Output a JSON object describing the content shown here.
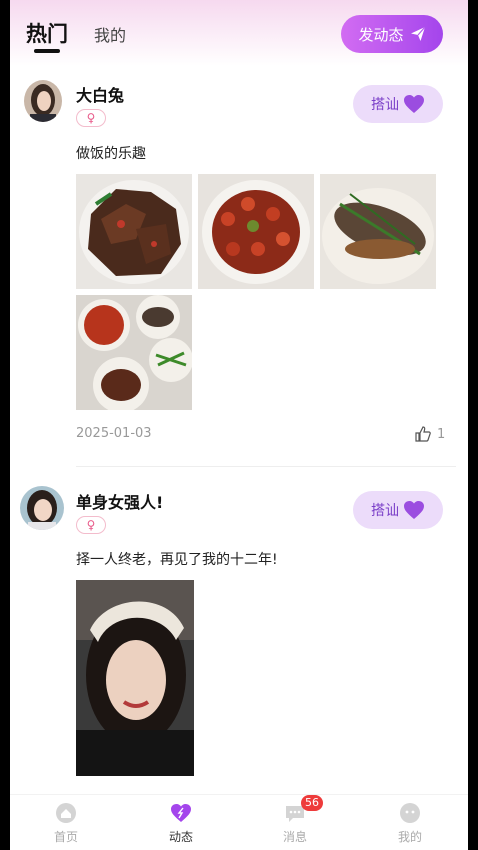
{
  "header": {
    "tab_hot": "热门",
    "tab_mine": "我的",
    "post_button": "发动态"
  },
  "posts": [
    {
      "username": "大白兔",
      "gender_symbol": "♀",
      "greet_label": "搭讪",
      "text": "做饭的乐趣",
      "date": "2025-01-03",
      "likes": "1"
    },
    {
      "username": "单身女强人!",
      "gender_symbol": "♀",
      "greet_label": "搭讪",
      "text": "择一人终老，再见了我的十二年!"
    }
  ],
  "tabbar": {
    "items": [
      {
        "label": "首页",
        "icon": "home-icon"
      },
      {
        "label": "动态",
        "icon": "feed-heart-icon"
      },
      {
        "label": "消息",
        "icon": "message-icon",
        "badge": "56"
      },
      {
        "label": "我的",
        "icon": "profile-icon"
      }
    ]
  },
  "colors": {
    "accent": "#a445ec",
    "greet_bg": "#ecdcfa",
    "badge": "#ee3b3b"
  }
}
